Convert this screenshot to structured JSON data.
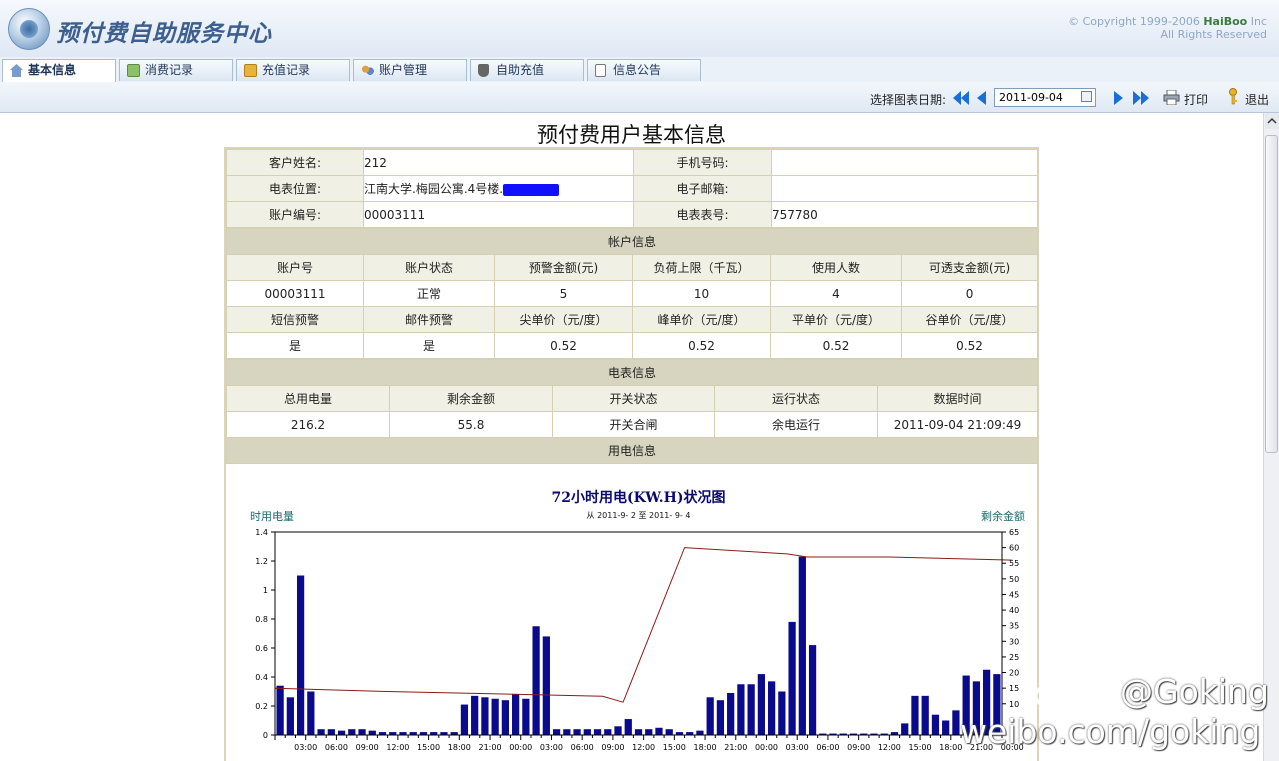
{
  "app": {
    "title": "预付费自助服务中心",
    "copyright_line1": "© Copyright 1999-2006 ",
    "copyright_brand": "HaiBoo",
    "copyright_inc": " Inc",
    "copyright_line2": "All Rights Reserved"
  },
  "tabs": [
    {
      "label": "基本信息",
      "active": true,
      "icon": "home-icon"
    },
    {
      "label": "消费记录",
      "active": false,
      "icon": "notepad-icon"
    },
    {
      "label": "充值记录",
      "active": false,
      "icon": "arrow-folder-icon"
    },
    {
      "label": "账户管理",
      "active": false,
      "icon": "users-icon"
    },
    {
      "label": "自助充值",
      "active": false,
      "icon": "plug-icon"
    },
    {
      "label": "信息公告",
      "active": false,
      "icon": "document-icon"
    }
  ],
  "toolbar": {
    "date_label": "选择图表日期:",
    "date_value": "2011-09-04",
    "print_label": "打印",
    "exit_label": "退出"
  },
  "page": {
    "heading": "预付费用户基本信息"
  },
  "customer": {
    "name_label": "客户姓名:",
    "name": "212",
    "phone_label": "手机号码:",
    "phone": "",
    "location_label": "电表位置:",
    "location": "江南大学.梅园公寓.4号楼.",
    "email_label": "电子邮箱:",
    "email": "",
    "account_no_label": "账户编号:",
    "account_no": "00003111",
    "meter_no_label": "电表表号:",
    "meter_no": "757780"
  },
  "account_section": {
    "title": "帐户信息",
    "headers1": [
      "账户号",
      "账户状态",
      "预警金额(元)",
      "负荷上限（千瓦）",
      "使用人数",
      "可透支金额(元)"
    ],
    "values1": [
      "00003111",
      "正常",
      "5",
      "10",
      "4",
      "0"
    ],
    "headers2": [
      "短信预警",
      "邮件预警",
      "尖单价（元/度）",
      "峰单价（元/度）",
      "平单价（元/度）",
      "谷单价（元/度）"
    ],
    "values2": [
      "是",
      "是",
      "0.52",
      "0.52",
      "0.52",
      "0.52"
    ]
  },
  "meter_section": {
    "title": "电表信息",
    "headers": [
      "总用电量",
      "剩余金额",
      "开关状态",
      "运行状态",
      "数据时间"
    ],
    "values": [
      "216.2",
      "55.8",
      "开关合闸",
      "余电运行",
      "2011-09-04 21:09:49"
    ]
  },
  "usage_section": {
    "title": "用电信息"
  },
  "chart_data": {
    "type": "bar",
    "title": "72小时用电(KW.H)状况图",
    "subtitle": "从 2011-9- 2 至  2011- 9- 4",
    "ylabel_left": "时用电量",
    "ylabel_right": "剩余金额",
    "ylim": [
      0,
      1.4
    ],
    "y2lim": [
      0,
      65
    ],
    "yticks": [
      "0",
      "0.2",
      "0.4",
      "0.6",
      "0.8",
      "1",
      "1.2",
      "1.4"
    ],
    "y2ticks": [
      "10",
      "15",
      "20",
      "25",
      "30",
      "35",
      "40",
      "45",
      "50",
      "55",
      "60",
      "65"
    ],
    "xticks": [
      "03:00",
      "06:00",
      "09:00",
      "12:00",
      "15:00",
      "18:00",
      "21:00",
      "00:00",
      "03:00",
      "06:00",
      "09:00",
      "12:00",
      "15:00",
      "18:00",
      "21:00",
      "00:00",
      "03:00",
      "06:00",
      "09:00",
      "12:00",
      "15:00",
      "18:00",
      "21:00",
      "00:00"
    ],
    "colors": {
      "bars": "#0a0a8c",
      "line": "#8b1a1a"
    },
    "series": [
      {
        "values": [
          0.34,
          0.26,
          1.1,
          0.3,
          0.04,
          0.04,
          0.03,
          0.04,
          0.04,
          0.03,
          0.02,
          0.02,
          0.02,
          0.02,
          0.02,
          0.02,
          0.02,
          0.02,
          0.21,
          0.27,
          0.26,
          0.25,
          0.24,
          0.28,
          0.25,
          0.75,
          0.68,
          0.04,
          0.04,
          0.04,
          0.04,
          0.04,
          0.04,
          0.06,
          0.11,
          0.04,
          0.04,
          0.05,
          0.04,
          0.02,
          0.02,
          0.03,
          0.26,
          0.24,
          0.29,
          0.35,
          0.35,
          0.42,
          0.37,
          0.3,
          0.78,
          1.23,
          0.62,
          0.01,
          0.01,
          0.01,
          0.01,
          0.01,
          0.01,
          0.01,
          0.02,
          0.08,
          0.27,
          0.27,
          0.14,
          0.1,
          0.17,
          0.41,
          0.37,
          0.45,
          0.42
        ]
      },
      {
        "line_x": [
          0,
          10,
          20,
          32,
          34,
          40,
          50,
          52,
          60,
          72
        ],
        "values": [
          15,
          14,
          13.3,
          12.4,
          10.5,
          60,
          58,
          57,
          57,
          56
        ]
      }
    ]
  }
}
